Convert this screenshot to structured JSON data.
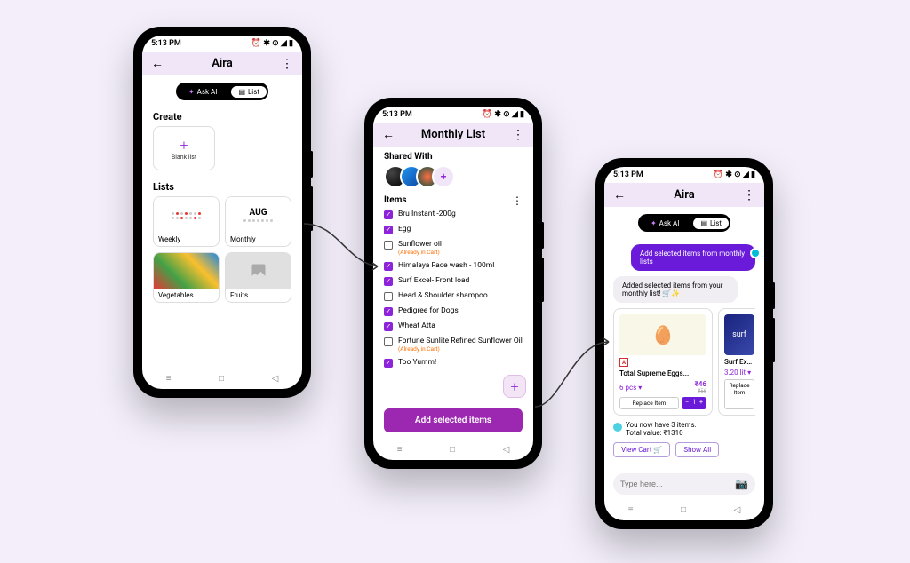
{
  "status": {
    "time": "5:13 PM",
    "icons": "⏰ ✱ ⊙ ◢ ▮"
  },
  "colors": {
    "accent": "#8e24d9"
  },
  "screen1": {
    "title": "Aira",
    "toggle": {
      "ask": "Ask AI",
      "list": "List"
    },
    "create_h": "Create",
    "blank": "Blank list",
    "lists_h": "Lists",
    "cards": [
      {
        "label": "Weekly"
      },
      {
        "label": "Monthly",
        "month": "AUG"
      },
      {
        "label": "Vegetables"
      },
      {
        "label": "Fruits"
      }
    ]
  },
  "screen2": {
    "title": "Monthly List",
    "shared_h": "Shared With",
    "items_h": "Items",
    "items": [
      {
        "name": "Bru Instant -200g",
        "checked": true
      },
      {
        "name": "Egg",
        "checked": true
      },
      {
        "name": "Sunflower oil",
        "checked": false,
        "note": "(Already in Cart)"
      },
      {
        "name": "Himalaya Face wash - 100ml",
        "checked": true
      },
      {
        "name": "Surf Excel- Front load",
        "checked": true
      },
      {
        "name": "Head & Shoulder shampoo",
        "checked": false
      },
      {
        "name": "Pedigree for Dogs",
        "checked": true
      },
      {
        "name": "Wheat Atta",
        "checked": true
      },
      {
        "name": "Fortune Sunlite Refined Sunflower Oil",
        "checked": false,
        "note": "(Already in Cart)"
      },
      {
        "name": "Too Yumm!",
        "checked": true
      }
    ],
    "button": "Add selected items"
  },
  "screen3": {
    "title": "Aira",
    "toggle": {
      "ask": "Ask AI",
      "list": "List"
    },
    "user_msg": "Add selected items from monthly lists",
    "bot_msg": "Added selected items from your monthly list! 🛒✨",
    "products": [
      {
        "name": "Total Supreme Eggs...",
        "qty": "6 pcs",
        "price": "₹46",
        "old": "₹56",
        "count": "1",
        "replace": "Replace Item"
      },
      {
        "name": "Surf Excel Mat...",
        "qty": "3.20 lit",
        "replace": "Replace Item"
      }
    ],
    "summary": {
      "line1": "You now have 3 items.",
      "line2": "Total value: ₹1310"
    },
    "view_cart": "View Cart 🛒",
    "show_all": "Show All",
    "placeholder": "Type here..."
  }
}
